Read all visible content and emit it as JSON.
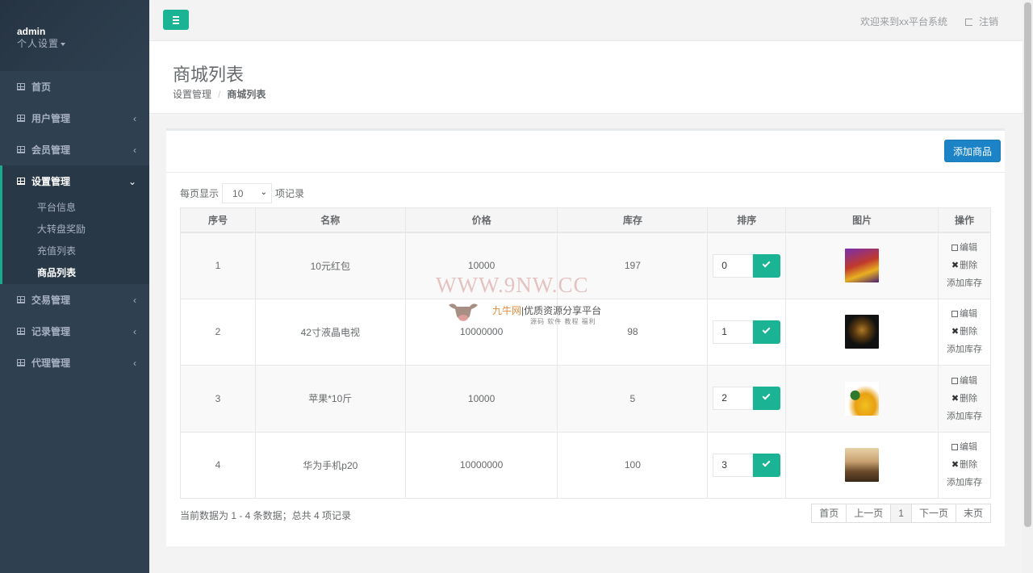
{
  "sidebar": {
    "user": "admin",
    "settings_label": "个人设置",
    "items": [
      {
        "label": "首页"
      },
      {
        "label": "用户管理",
        "arrow": "‹"
      },
      {
        "label": "会员管理",
        "arrow": "‹"
      }
    ],
    "active_group": {
      "label": "设置管理",
      "arrow": "⌄",
      "children": [
        "平台信息",
        "大转盘奖励",
        "充值列表",
        "商品列表"
      ]
    },
    "items_after": [
      {
        "label": "交易管理",
        "arrow": "‹"
      },
      {
        "label": "记录管理",
        "arrow": "‹"
      },
      {
        "label": "代理管理",
        "arrow": "‹"
      }
    ]
  },
  "topbar": {
    "welcome": "欢迎来到xx平台系统",
    "logout": "注销"
  },
  "page": {
    "title": "商城列表",
    "breadcrumb": [
      "设置管理",
      "商城列表"
    ]
  },
  "toolbar": {
    "add_label": "添加商品"
  },
  "length": {
    "prefix": "每页显示",
    "value": "10",
    "suffix": "项记录"
  },
  "table": {
    "headers": [
      "序号",
      "名称",
      "价格",
      "库存",
      "排序",
      "图片",
      "操作"
    ],
    "rows": [
      {
        "id": "1",
        "name": "10元红包",
        "price": "10000",
        "stock": "197",
        "sort": "0"
      },
      {
        "id": "2",
        "name": "42寸液晶电视",
        "price": "10000000",
        "stock": "98",
        "sort": "1"
      },
      {
        "id": "3",
        "name": "苹果*10斤",
        "price": "10000",
        "stock": "5",
        "sort": "2"
      },
      {
        "id": "4",
        "name": "华为手机p20",
        "price": "10000000",
        "stock": "100",
        "sort": "3"
      }
    ],
    "ops": {
      "edit": "编辑",
      "delete": "删除",
      "add_stock": "添加库存"
    }
  },
  "footer": {
    "info": "当前数据为 1 - 4 条数据；总共 4 项记录",
    "pager": [
      "首页",
      "上一页",
      "1",
      "下一页",
      "末页"
    ]
  },
  "watermark": {
    "site": "WWW.9NW.CC",
    "brand": "九牛网",
    "slogan": "优质资源分享平台",
    "tags": "源码 软件 教程 福利"
  },
  "colors": {
    "sidebar_bg": "#2f4050",
    "accent_green": "#1ab394",
    "button_blue": "#1c84c6"
  }
}
